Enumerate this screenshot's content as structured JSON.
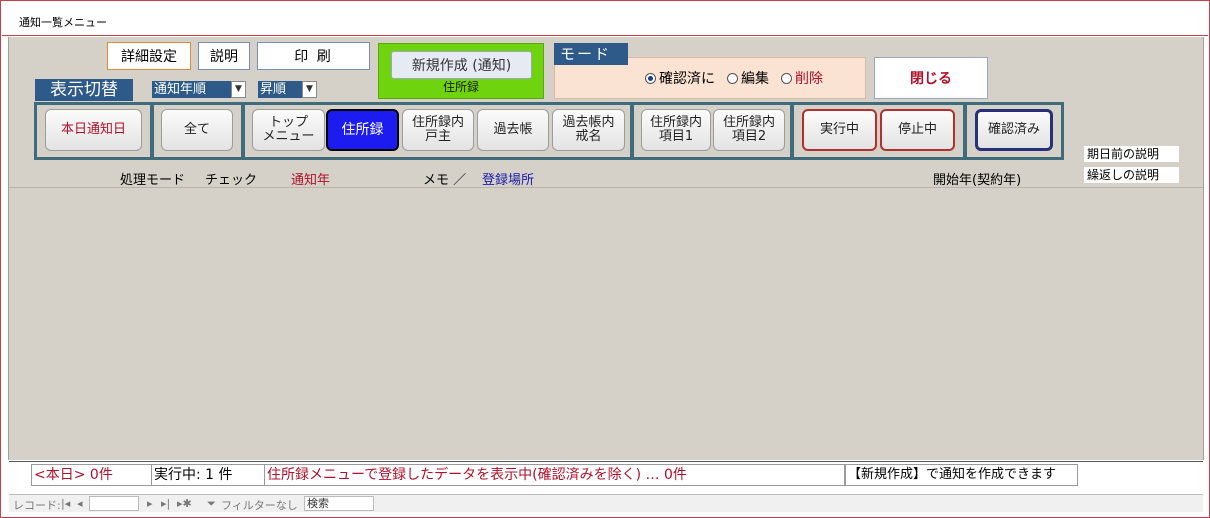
{
  "window": {
    "title": "通知一覧メニュー"
  },
  "toolbar": {
    "detail_settings": "詳細設定",
    "description": "説明",
    "print": "印 刷",
    "new_create": "新規作成 (通知)",
    "new_create_caption": "住所録",
    "mode_label": "モード",
    "mode_options": [
      "確認済に",
      "編集",
      "削除"
    ],
    "mode_selected": "確認済に",
    "close": "閉じる",
    "display_switch": "表示切替",
    "sort_field": "通知年順",
    "sort_order": "昇順"
  },
  "filter_buttons": {
    "today": "本日通知日",
    "all": "全て",
    "top_menu_1": "トップ",
    "top_menu_2": "メニュー",
    "address_book": "住所録",
    "address_head_1": "住所録内",
    "address_head_2": "戸主",
    "past_book": "過去帳",
    "past_name_1": "過去帳内",
    "past_name_2": "戒名",
    "item1_1": "住所録内",
    "item1_2": "項目1",
    "item2_1": "住所録内",
    "item2_2": "項目2",
    "running": "実行中",
    "stopped": "停止中",
    "confirmed": "確認済み",
    "active": "住所録"
  },
  "side_labels": {
    "before_due": "期日前の説明",
    "repeat": "繰返しの説明"
  },
  "columns": {
    "mode": "処理モード",
    "check": "チェック",
    "notify_year": "通知年",
    "memo": "メモ ／",
    "reg_place": "登録場所",
    "start_year": "開始年(契約年)"
  },
  "status": {
    "today_count": "<本日> 0件",
    "running_count": "実行中: 1 件",
    "message": "住所録メニューで登録したデータを表示中(確認済みを除く) … 0件",
    "hint": "【新規作成】で通知を作成できます"
  },
  "navigation": {
    "record_label": "レコード:",
    "filter_label": "フィルターなし",
    "search_label": "検索"
  },
  "colors": {
    "accent_blue": "#2e5a8a",
    "active_button": "#1c1cf0",
    "alert_red": "#b0102a",
    "green": "#6fd40e"
  }
}
